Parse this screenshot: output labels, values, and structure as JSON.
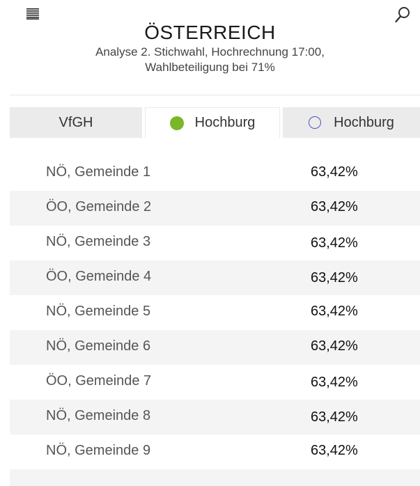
{
  "header": {
    "title": "ÖSTERREICH",
    "subtitle_line1": "Analyse 2. Stichwahl, Hochrechnung 17:00,",
    "subtitle_line2": "Wahlbeteiligung bei 71%"
  },
  "icons": {
    "menu": "hamburger-menu-icon",
    "search": "search-icon",
    "candidate_1_marker": "filled-circle-icon",
    "candidate_2_marker": "outline-circle-icon"
  },
  "colors": {
    "candidate_1": "#7ab62a",
    "candidate_2": "#4a55b5",
    "tab_inactive_bg": "#ebebeb",
    "row_stripe_bg": "#f4f4f4"
  },
  "tabs": [
    {
      "label": "VfGH",
      "active": false
    },
    {
      "label": "Hochburg",
      "active": true
    },
    {
      "label": "Hochburg",
      "active": false
    }
  ],
  "rows": [
    {
      "name": "NÖ, Gemeinde 1",
      "value": "63,42%"
    },
    {
      "name": "ÖO, Gemeinde 2",
      "value": "63,42%"
    },
    {
      "name": "NÖ, Gemeinde 3",
      "value": "63,42%"
    },
    {
      "name": "ÖO, Gemeinde 4",
      "value": "63,42%"
    },
    {
      "name": "NÖ, Gemeinde 5",
      "value": "63,42%"
    },
    {
      "name": "NÖ, Gemeinde 6",
      "value": "63,42%"
    },
    {
      "name": "ÖO, Gemeinde 7",
      "value": "63,42%"
    },
    {
      "name": "NÖ, Gemeinde 8",
      "value": "63,42%"
    },
    {
      "name": "NÖ, Gemeinde 9",
      "value": "63,42%"
    }
  ]
}
